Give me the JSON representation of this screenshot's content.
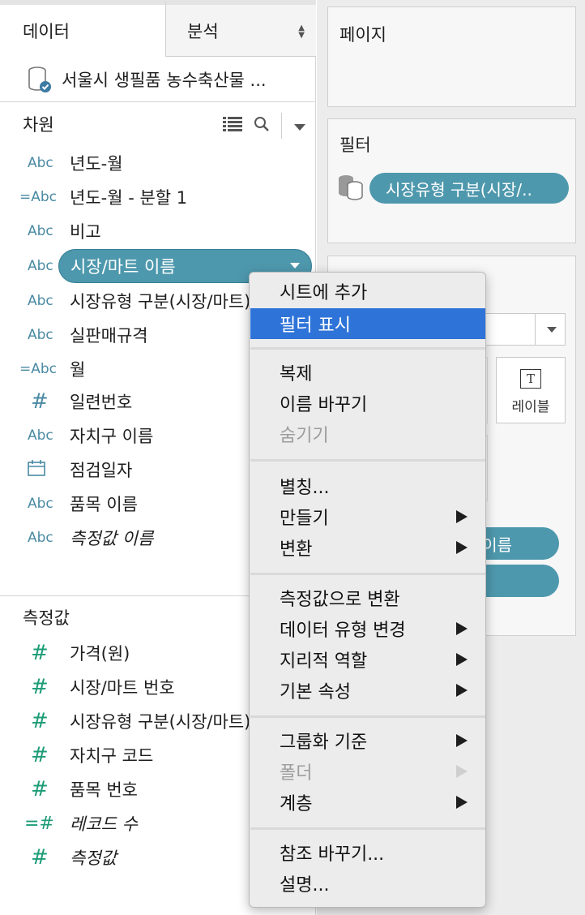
{
  "tabs": {
    "data": "데이터",
    "analysis": "분석"
  },
  "datasource": {
    "name": "서울시 생필품 농수축산물 ..."
  },
  "dimensions": {
    "header": "차원",
    "fields": [
      {
        "type": "Abc",
        "name": "년도-월"
      },
      {
        "type": "=Abc",
        "name": "년도-월 - 분할 1"
      },
      {
        "type": "Abc",
        "name": "비고"
      },
      {
        "type": "Abc",
        "name": "시장/마트 이름"
      },
      {
        "type": "Abc",
        "name": "시장유형 구분(시장/마트)"
      },
      {
        "type": "Abc",
        "name": "실판매규격"
      },
      {
        "type": "=Abc",
        "name": "월"
      },
      {
        "type": "#",
        "name": "일련번호"
      },
      {
        "type": "Abc",
        "name": "자치구 이름"
      },
      {
        "type": "date",
        "name": "점검일자"
      },
      {
        "type": "Abc",
        "name": "품목 이름"
      },
      {
        "type": "Abc",
        "name": "측정값 이름"
      }
    ]
  },
  "measures": {
    "header": "측정값",
    "fields": [
      {
        "type": "#",
        "name": "가격(원)"
      },
      {
        "type": "#",
        "name": "시장/마트 번호"
      },
      {
        "type": "#",
        "name": "시장유형 구분(시장/마트)"
      },
      {
        "type": "#",
        "name": "자치구 코드"
      },
      {
        "type": "#",
        "name": "품목 번호"
      },
      {
        "type": "=#",
        "name": "레코드 수"
      },
      {
        "type": "#",
        "name": "측정값"
      }
    ]
  },
  "shelves": {
    "pages": "페이지",
    "filters": "필터",
    "filter_pill": "시장유형 구분(시장/..",
    "marks_pill": "이름",
    "label_button": "레이블",
    "label_icon": "T"
  },
  "context_menu": {
    "items": [
      {
        "label": "시트에 추가"
      },
      {
        "label": "필터 표시",
        "highlighted": true
      },
      {
        "label": "복제"
      },
      {
        "label": "이름 바꾸기"
      },
      {
        "label": "숨기기",
        "disabled": true
      },
      {
        "label": "별칭..."
      },
      {
        "label": "만들기",
        "submenu": true
      },
      {
        "label": "변환",
        "submenu": true
      },
      {
        "label": "측정값으로 변환"
      },
      {
        "label": "데이터 유형 변경",
        "submenu": true
      },
      {
        "label": "지리적 역할",
        "submenu": true
      },
      {
        "label": "기본 속성",
        "submenu": true
      },
      {
        "label": "그룹화 기준",
        "submenu": true
      },
      {
        "label": "폴더",
        "submenu": true,
        "disabled": true
      },
      {
        "label": "계층",
        "submenu": true
      },
      {
        "label": "참조 바꾸기..."
      },
      {
        "label": "설명..."
      }
    ]
  },
  "colors": {
    "pill": "#4e98ad",
    "highlight": "#2e73d8",
    "dimension_icon": "#4a8aa3",
    "measure_icon": "#1d9c77"
  }
}
